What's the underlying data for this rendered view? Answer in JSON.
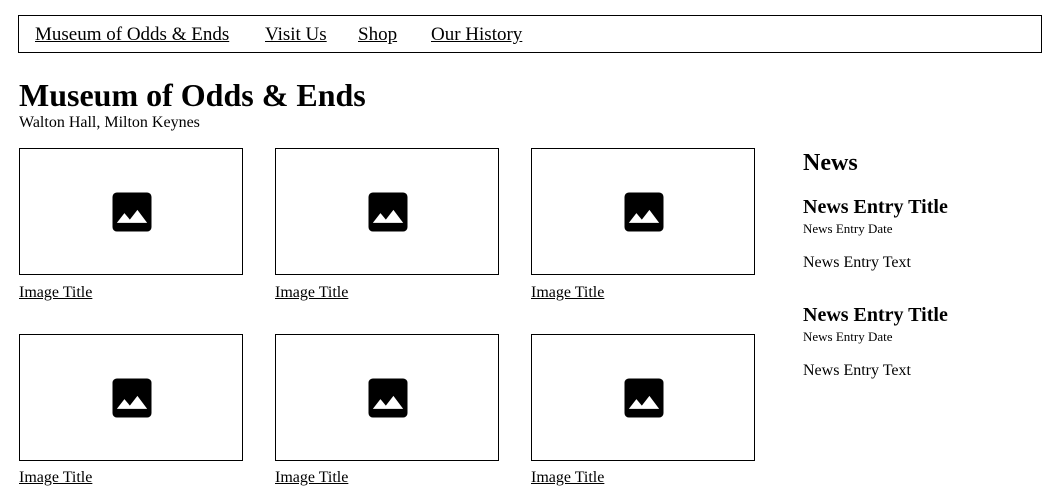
{
  "nav": {
    "items": [
      {
        "label": "Museum of Odds & Ends"
      },
      {
        "label": "Visit Us"
      },
      {
        "label": "Shop"
      },
      {
        "label": "Our History"
      }
    ]
  },
  "header": {
    "title": "Museum of Odds & Ends",
    "subtitle": "Walton Hall, Milton Keynes"
  },
  "gallery": {
    "items": [
      {
        "icon": "image-icon",
        "title": "Image Title"
      },
      {
        "icon": "image-icon",
        "title": "Image Title"
      },
      {
        "icon": "image-icon",
        "title": "Image Title"
      },
      {
        "icon": "image-icon",
        "title": "Image Title"
      },
      {
        "icon": "image-icon",
        "title": "Image Title"
      },
      {
        "icon": "image-icon",
        "title": "Image Title"
      }
    ]
  },
  "news": {
    "heading": "News",
    "entries": [
      {
        "title": "News Entry Title",
        "date": "News Entry Date",
        "text": "News Entry Text"
      },
      {
        "title": "News Entry Title",
        "date": "News Entry Date",
        "text": "News Entry Text"
      }
    ]
  }
}
